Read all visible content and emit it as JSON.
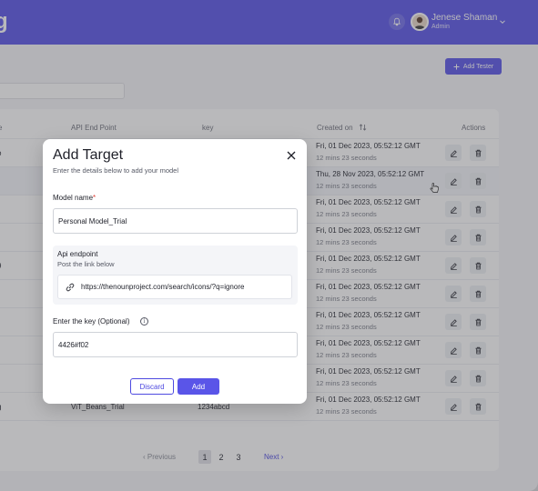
{
  "header": {
    "logo_fragment": "g",
    "user_name": "Jenese Shaman",
    "user_role": "Admin",
    "bell_icon": "bell-icon",
    "chevron_icon": "chevron-down-icon",
    "accent": "#5a55e8"
  },
  "toolbar": {
    "add_tester_label": "Add Tester",
    "add_icon": "plus-icon"
  },
  "table": {
    "headers": {
      "name_fragment": "e",
      "api": "API End Point",
      "key": "key",
      "created": "Created on",
      "actions": "Actions"
    },
    "rows": [
      {
        "left": "o",
        "date": "Fri, 01 Dec 2023, 05:52:12 GMT",
        "ago": "12 mins 23 seconds"
      },
      {
        "left": "",
        "date": "Thu, 28 Nov 2023, 05:52:12 GMT",
        "ago": "12 mins 23 seconds"
      },
      {
        "left": "",
        "date": "Fri, 01 Dec 2023, 05:52:12 GMT",
        "ago": "12 mins 23 seconds"
      },
      {
        "left": "",
        "date": "Fri, 01 Dec 2023, 05:52:12 GMT",
        "ago": "12 mins 23 seconds"
      },
      {
        "left": "9",
        "date": "Fri, 01 Dec 2023, 05:52:12 GMT",
        "ago": "12 mins 23 seconds"
      },
      {
        "left": "",
        "date": "Fri, 01 Dec 2023, 05:52:12 GMT",
        "ago": "12 mins 23 seconds"
      },
      {
        "left": "",
        "date": "Fri, 01 Dec 2023, 05:52:12 GMT",
        "ago": "12 mins 23 seconds"
      },
      {
        "left": "",
        "date": "Fri, 01 Dec 2023, 05:52:12 GMT",
        "ago": "12 mins 23 seconds"
      },
      {
        "left": "",
        "date": "Fri, 01 Dec 2023, 05:52:12 GMT",
        "ago": "12 mins 23 seconds"
      },
      {
        "left": "g",
        "api": "ViT_Beans_Trial",
        "key": "1234abcd",
        "date": "Fri, 01 Dec 2023, 05:52:12 GMT",
        "ago": "12 mins 23 seconds"
      }
    ],
    "edit_icon": "pencil-icon",
    "delete_icon": "trash-icon"
  },
  "pagination": {
    "prev": "‹ Previous",
    "pages": [
      "1",
      "2",
      "3"
    ],
    "current": "1",
    "next": "Next ›"
  },
  "modal": {
    "title": "Add Target",
    "subtitle": "Enter the details below to add your model",
    "model_name_label": "Model name",
    "required_mark": "*",
    "model_name_value": "Personal Model_Trial",
    "api_title": "Api endpoint",
    "api_subtitle": "Post the link below",
    "api_value": "https://thenounproject.com/search/icons/?q=ignore",
    "key_label": "Enter the key (Optional)",
    "key_value": "4426#f02",
    "discard_label": "Discard",
    "add_label": "Add",
    "info_glyph": "i",
    "close_icon": "close-icon",
    "link_icon": "link-icon"
  }
}
